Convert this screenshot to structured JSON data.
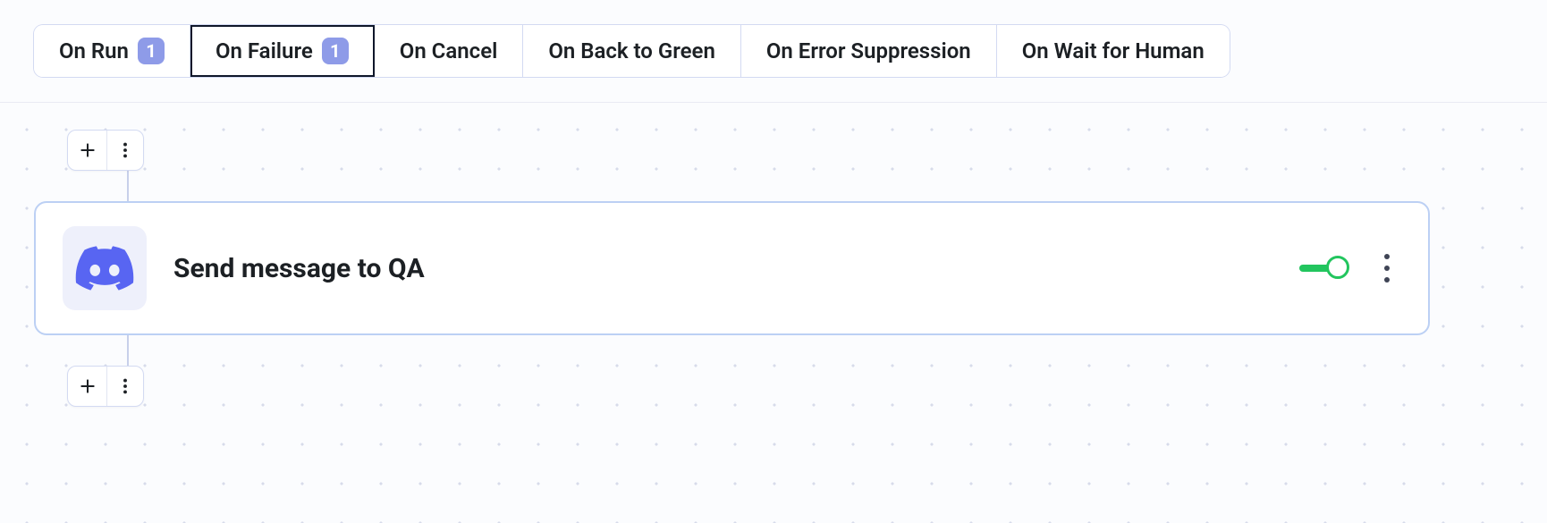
{
  "tabs": [
    {
      "label": "On Run",
      "badge": "1",
      "selected": false
    },
    {
      "label": "On Failure",
      "badge": "1",
      "selected": true
    },
    {
      "label": "On Cancel",
      "badge": null,
      "selected": false
    },
    {
      "label": "On Back to Green",
      "badge": null,
      "selected": false
    },
    {
      "label": "On Error Suppression",
      "badge": null,
      "selected": false
    },
    {
      "label": "On Wait for Human",
      "badge": null,
      "selected": false
    }
  ],
  "step": {
    "title": "Send message to QA",
    "app_icon": "discord",
    "enabled": true
  }
}
